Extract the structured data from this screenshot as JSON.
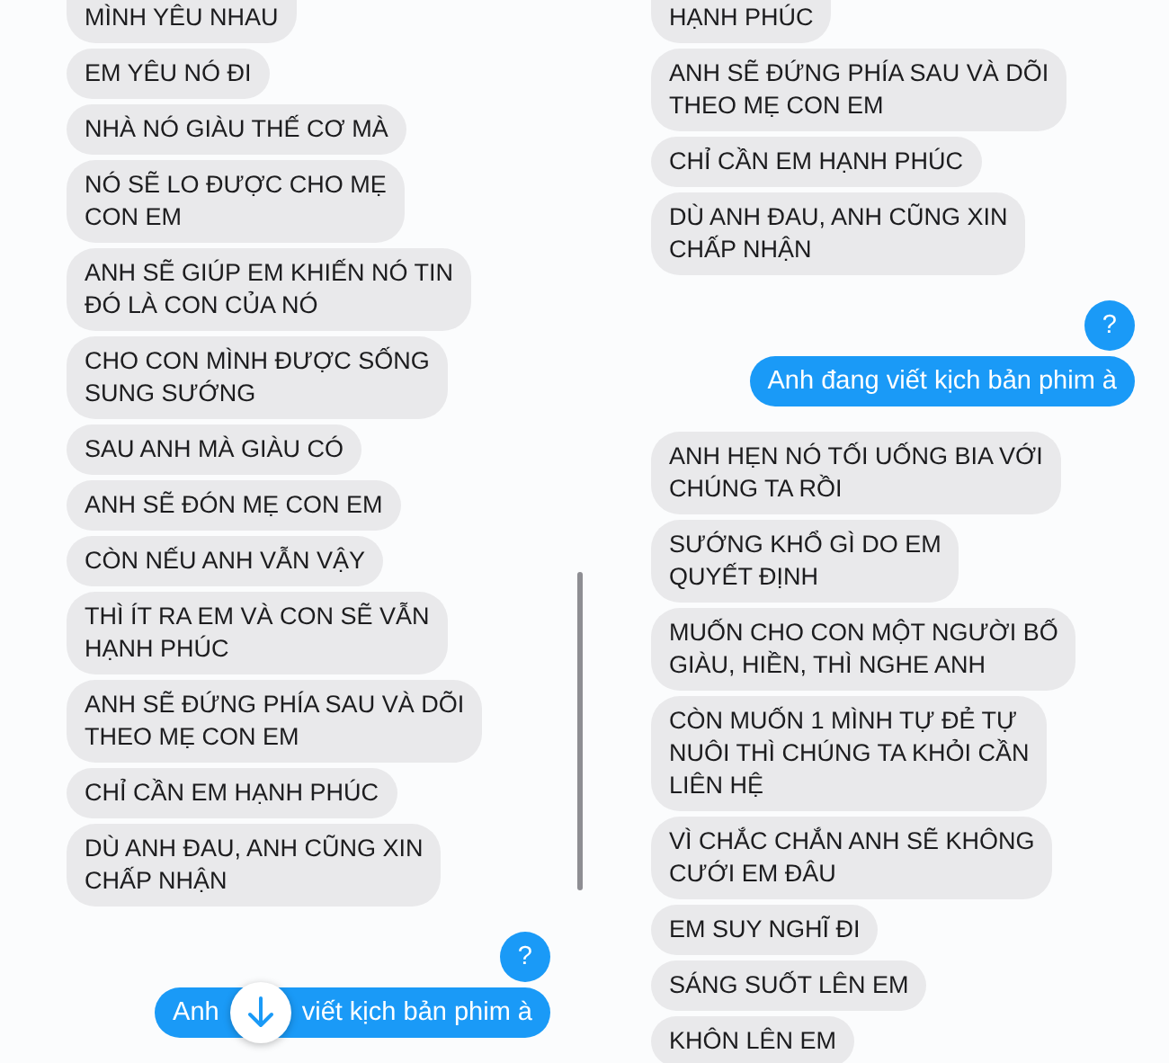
{
  "panels": [
    {
      "scrollbar": true,
      "scroll_to_bottom": true,
      "messages": [
        {
          "kind": "received",
          "cut_top": true,
          "lines": [
            "MÌNH YÊU NHAU"
          ]
        },
        {
          "kind": "received",
          "lines": [
            "EM YÊU NÓ ĐI"
          ]
        },
        {
          "kind": "received",
          "lines": [
            "NHÀ NÓ GIÀU THẾ CƠ MÀ"
          ]
        },
        {
          "kind": "received",
          "lines": [
            "NÓ SẼ LO ĐƯỢC CHO MẸ",
            "CON EM"
          ]
        },
        {
          "kind": "received",
          "lines": [
            "ANH SẼ GIÚP EM KHIẾN NÓ TIN",
            "ĐÓ LÀ CON CỦA NÓ"
          ]
        },
        {
          "kind": "received",
          "lines": [
            "CHO CON MÌNH ĐƯỢC SỐNG",
            "SUNG SƯỚNG"
          ]
        },
        {
          "kind": "received",
          "lines": [
            "SAU ANH MÀ GIÀU CÓ"
          ]
        },
        {
          "kind": "received",
          "lines": [
            "ANH SẼ ĐÓN MẸ CON EM"
          ]
        },
        {
          "kind": "received",
          "lines": [
            "CÒN NẾU ANH VẪN VẬY"
          ]
        },
        {
          "kind": "received",
          "lines": [
            "THÌ ÍT RA EM VÀ CON SẼ VẪN",
            "HẠNH PHÚC"
          ]
        },
        {
          "kind": "received",
          "lines": [
            "ANH SẼ ĐỨNG PHÍA SAU VÀ DÕI",
            "THEO MẸ CON EM"
          ]
        },
        {
          "kind": "received",
          "lines": [
            "CHỈ CẦN EM HẠNH PHÚC"
          ]
        },
        {
          "kind": "received",
          "lines": [
            "DÙ ANH ĐAU, ANH CŨNG XIN",
            "CHẤP NHẬN"
          ]
        },
        {
          "kind": "sent",
          "lines": [
            "?"
          ]
        },
        {
          "kind": "sent",
          "parts": [
            "Anh",
            "viết kịch bản phim à"
          ]
        }
      ]
    },
    {
      "messages": [
        {
          "kind": "received",
          "cut_top": true,
          "lines": [
            "HẠNH PHÚC"
          ]
        },
        {
          "kind": "received",
          "lines": [
            "ANH SẼ ĐỨNG PHÍA SAU VÀ DÕI",
            "THEO MẸ CON EM"
          ]
        },
        {
          "kind": "received",
          "lines": [
            "CHỈ CẦN EM HẠNH PHÚC"
          ]
        },
        {
          "kind": "received",
          "lines": [
            "DÙ ANH ĐAU, ANH CŨNG XIN",
            "CHẤP NHẬN"
          ]
        },
        {
          "kind": "sent",
          "lines": [
            "?"
          ]
        },
        {
          "kind": "sent",
          "lines": [
            "Anh đang viết kịch bản phim à"
          ]
        },
        {
          "kind": "received",
          "lines": [
            "ANH HẸN NÓ TỐI UỐNG BIA VỚI",
            "CHÚNG TA RỒI"
          ]
        },
        {
          "kind": "received",
          "lines": [
            "SƯỚNG KHỔ GÌ DO EM",
            "QUYẾT ĐỊNH"
          ]
        },
        {
          "kind": "received",
          "lines": [
            "MUỐN CHO CON MỘT NGƯỜI BỐ",
            "GIÀU, HIỀN, THÌ NGHE ANH"
          ]
        },
        {
          "kind": "received",
          "lines": [
            "CÒN MUỐN 1 MÌNH TỰ ĐẺ TỰ",
            "NUÔI THÌ CHÚNG TA KHỎI CẦN",
            "LIÊN HỆ"
          ]
        },
        {
          "kind": "received",
          "lines": [
            "VÌ CHẮC CHẮN ANH SẼ KHÔNG",
            "CƯỚI EM ĐÂU"
          ]
        },
        {
          "kind": "received",
          "lines": [
            "EM SUY NGHĨ ĐI"
          ]
        },
        {
          "kind": "received",
          "lines": [
            "SÁNG SUỐT LÊN EM"
          ]
        },
        {
          "kind": "received",
          "lines": [
            "KHÔN LÊN EM"
          ]
        }
      ]
    }
  ]
}
